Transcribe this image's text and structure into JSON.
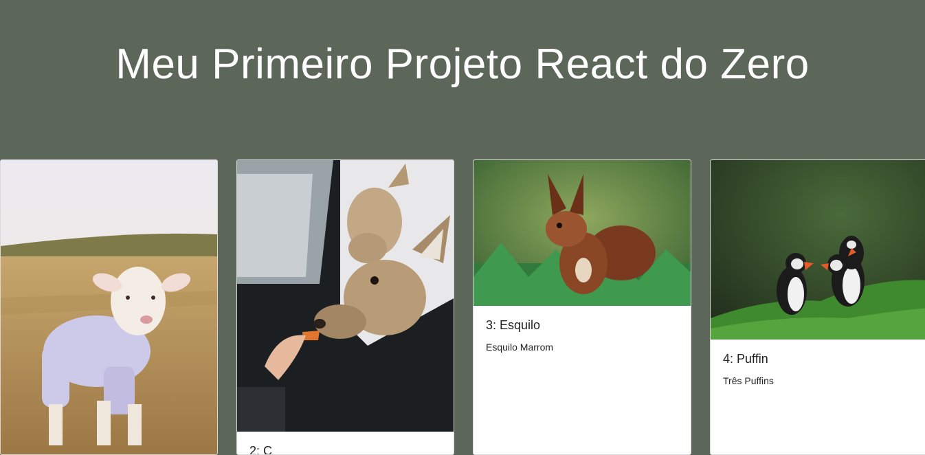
{
  "header": {
    "title": "Meu Primeiro Projeto React do Zero"
  },
  "cards": [
    {
      "title": "",
      "text": "",
      "image": "lamb-in-sweater-photo"
    },
    {
      "title": "2: C",
      "text": "",
      "image": "deer-at-car-window-photo"
    },
    {
      "title": "3: Esquilo",
      "text": "Esquilo Marrom",
      "image": "red-squirrel-photo"
    },
    {
      "title": "4: Puffin",
      "text": "Três Puffins",
      "image": "puffins-on-grass-photo"
    }
  ],
  "colors": {
    "background": "#5c6659",
    "card": "#ffffff",
    "title_text": "#ffffff"
  }
}
